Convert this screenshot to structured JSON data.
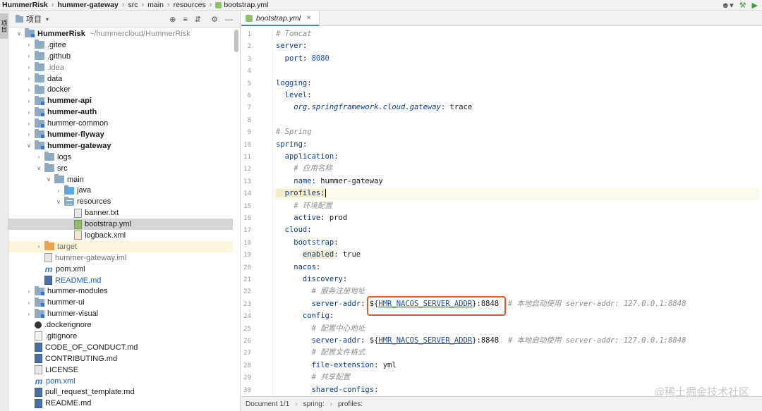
{
  "breadcrumb": [
    "HummerRisk",
    "hummer-gateway",
    "src",
    "main",
    "resources",
    "bootstrap.yml"
  ],
  "project_panel": {
    "tab_label": "项目",
    "title": "项目"
  },
  "tree": [
    {
      "label": "HummerRisk",
      "hint": "~/hummercloud/HummerRisk",
      "indent": 0,
      "arrow": "down",
      "icon": "folder module",
      "style": "bold"
    },
    {
      "label": ".gitee",
      "indent": 1,
      "arrow": "right",
      "icon": "folder",
      "style": ""
    },
    {
      "label": ".github",
      "indent": 1,
      "arrow": "right",
      "icon": "folder",
      "style": ""
    },
    {
      "label": ".idea",
      "indent": 1,
      "arrow": "right",
      "icon": "folder",
      "style": "gray"
    },
    {
      "label": "data",
      "indent": 1,
      "arrow": "right",
      "icon": "folder",
      "style": ""
    },
    {
      "label": "docker",
      "indent": 1,
      "arrow": "right",
      "icon": "folder",
      "style": ""
    },
    {
      "label": "hummer-api",
      "indent": 1,
      "arrow": "right",
      "icon": "folder module",
      "style": "bold"
    },
    {
      "label": "hummer-auth",
      "indent": 1,
      "arrow": "right",
      "icon": "folder module",
      "style": "bold"
    },
    {
      "label": "hummer-common",
      "indent": 1,
      "arrow": "right",
      "icon": "folder module",
      "style": ""
    },
    {
      "label": "hummer-flyway",
      "indent": 1,
      "arrow": "right",
      "icon": "folder module",
      "style": "bold"
    },
    {
      "label": "hummer-gateway",
      "indent": 1,
      "arrow": "down",
      "icon": "folder module",
      "style": "bold"
    },
    {
      "label": "logs",
      "indent": 2,
      "arrow": "right",
      "icon": "folder",
      "style": ""
    },
    {
      "label": "src",
      "indent": 2,
      "arrow": "down",
      "icon": "folder",
      "style": ""
    },
    {
      "label": "main",
      "indent": 3,
      "arrow": "down",
      "icon": "folder",
      "style": ""
    },
    {
      "label": "java",
      "indent": 4,
      "arrow": "right",
      "icon": "folder blue",
      "style": ""
    },
    {
      "label": "resources",
      "indent": 4,
      "arrow": "down",
      "icon": "folder res",
      "style": ""
    },
    {
      "label": "banner.txt",
      "indent": 5,
      "arrow": "none",
      "icon": "file",
      "style": ""
    },
    {
      "label": "bootstrap.yml",
      "indent": 5,
      "arrow": "none",
      "icon": "file file-yml",
      "style": "",
      "selected": true
    },
    {
      "label": "logback.xml",
      "indent": 5,
      "arrow": "none",
      "icon": "file file-xml",
      "style": ""
    },
    {
      "label": "target",
      "indent": 2,
      "arrow": "right",
      "icon": "folder orange",
      "style": "dim",
      "highlight": true
    },
    {
      "label": "hummer-gateway.iml",
      "indent": 2,
      "arrow": "none",
      "icon": "file",
      "style": "dim"
    },
    {
      "label": "pom.xml",
      "indent": 2,
      "arrow": "none",
      "icon": "file-m",
      "style": ""
    },
    {
      "label": "README.md",
      "indent": 2,
      "arrow": "none",
      "icon": "file file-md",
      "style": "blue"
    },
    {
      "label": "hummer-modules",
      "indent": 1,
      "arrow": "right",
      "icon": "folder module",
      "style": ""
    },
    {
      "label": "hummer-ui",
      "indent": 1,
      "arrow": "right",
      "icon": "folder module",
      "style": ""
    },
    {
      "label": "hummer-visual",
      "indent": 1,
      "arrow": "right",
      "icon": "folder module",
      "style": ""
    },
    {
      "label": ".dockerignore",
      "indent": 1,
      "arrow": "none",
      "icon": "file file-dock",
      "style": ""
    },
    {
      "label": ".gitignore",
      "indent": 1,
      "arrow": "none",
      "icon": "file file-git",
      "style": ""
    },
    {
      "label": "CODE_OF_CONDUCT.md",
      "indent": 1,
      "arrow": "none",
      "icon": "file file-md",
      "style": ""
    },
    {
      "label": "CONTRIBUTING.md",
      "indent": 1,
      "arrow": "none",
      "icon": "file file-md",
      "style": ""
    },
    {
      "label": "LICENSE",
      "indent": 1,
      "arrow": "none",
      "icon": "file",
      "style": ""
    },
    {
      "label": "pom.xml",
      "indent": 1,
      "arrow": "none",
      "icon": "file-m",
      "style": "blue"
    },
    {
      "label": "pull_request_template.md",
      "indent": 1,
      "arrow": "none",
      "icon": "file file-md",
      "style": ""
    },
    {
      "label": "README.md",
      "indent": 1,
      "arrow": "none",
      "icon": "file file-md",
      "style": ""
    }
  ],
  "editor": {
    "tab_label": "bootstrap.yml",
    "lines": [
      [
        {
          "t": "# Tomcat",
          "c": "c-comment"
        }
      ],
      [
        {
          "t": "server",
          "c": "c-key"
        },
        {
          "t": ":",
          "c": ""
        }
      ],
      [
        {
          "t": "  port",
          "c": "c-key"
        },
        {
          "t": ": ",
          "c": ""
        },
        {
          "t": "8080",
          "c": "c-num"
        }
      ],
      [],
      [
        {
          "t": "logging",
          "c": "c-key"
        },
        {
          "t": ":",
          "c": ""
        }
      ],
      [
        {
          "t": "  level",
          "c": "c-key"
        },
        {
          "t": ":",
          "c": ""
        }
      ],
      [
        {
          "t": "    org.springframework.cloud.gateway",
          "c": "c-key c-italic"
        },
        {
          "t": ": trace",
          "c": ""
        }
      ],
      [],
      [
        {
          "t": "# Spring",
          "c": "c-comment"
        }
      ],
      [
        {
          "t": "spring",
          "c": "c-key"
        },
        {
          "t": ":",
          "c": ""
        }
      ],
      [
        {
          "t": "  application",
          "c": "c-key"
        },
        {
          "t": ":",
          "c": ""
        }
      ],
      [
        {
          "t": "    # 应用名称",
          "c": "c-comment"
        }
      ],
      [
        {
          "t": "    name",
          "c": "c-key"
        },
        {
          "t": ": hummer-gateway",
          "c": ""
        }
      ],
      [
        {
          "t": "  profiles",
          "c": "c-key hl-key"
        },
        {
          "t": ":",
          "c": "hl-key"
        }
      ],
      [
        {
          "t": "    # 环境配置",
          "c": "c-comment"
        }
      ],
      [
        {
          "t": "    active",
          "c": "c-key"
        },
        {
          "t": ": prod",
          "c": ""
        }
      ],
      [
        {
          "t": "  cloud",
          "c": "c-key"
        },
        {
          "t": ":",
          "c": ""
        }
      ],
      [
        {
          "t": "    bootstrap",
          "c": "c-key"
        },
        {
          "t": ":",
          "c": ""
        }
      ],
      [
        {
          "t": "      ",
          "c": ""
        },
        {
          "t": "enabled",
          "c": "c-key hl-key"
        },
        {
          "t": ": true",
          "c": ""
        }
      ],
      [
        {
          "t": "    nacos",
          "c": "c-key"
        },
        {
          "t": ":",
          "c": ""
        }
      ],
      [
        {
          "t": "      discovery",
          "c": "c-key"
        },
        {
          "t": ":",
          "c": ""
        }
      ],
      [
        {
          "t": "        # 服务注册地址",
          "c": "c-comment"
        }
      ],
      [
        {
          "t": "        server-addr",
          "c": "c-key"
        },
        {
          "t": ": ${",
          "c": ""
        },
        {
          "t": "HMR_NACOS_SERVER_ADDR",
          "c": "c-var"
        },
        {
          "t": "}:8848  ",
          "c": ""
        },
        {
          "t": "# 本地启动使用 server-addr: 127.0.0.1:8848",
          "c": "c-comment"
        }
      ],
      [
        {
          "t": "      config",
          "c": "c-key"
        },
        {
          "t": ":",
          "c": ""
        }
      ],
      [
        {
          "t": "        # 配置中心地址",
          "c": "c-comment"
        }
      ],
      [
        {
          "t": "        server-addr",
          "c": "c-key"
        },
        {
          "t": ": ${",
          "c": ""
        },
        {
          "t": "HMR_NACOS_SERVER_ADDR",
          "c": "c-var"
        },
        {
          "t": "}:8848  ",
          "c": ""
        },
        {
          "t": "# 本地启动使用 server-addr: 127.0.0.1:8848",
          "c": "c-comment"
        }
      ],
      [
        {
          "t": "        # 配置文件格式",
          "c": "c-comment"
        }
      ],
      [
        {
          "t": "        file-extension",
          "c": "c-key"
        },
        {
          "t": ": yml",
          "c": ""
        }
      ],
      [
        {
          "t": "        # 共享配置",
          "c": "c-comment"
        }
      ],
      [
        {
          "t": "        shared-configs",
          "c": "c-key"
        },
        {
          "t": ":",
          "c": ""
        }
      ]
    ],
    "current_line": 14
  },
  "status": {
    "document": "Document 1/1",
    "path1": "spring:",
    "path2": "profiles:"
  },
  "watermark": "@稀土掘金技术社区",
  "colors": {
    "highlight_box": "#e25a2b",
    "keyword": "#0a3a8a",
    "selection": "#d5d5d5"
  }
}
